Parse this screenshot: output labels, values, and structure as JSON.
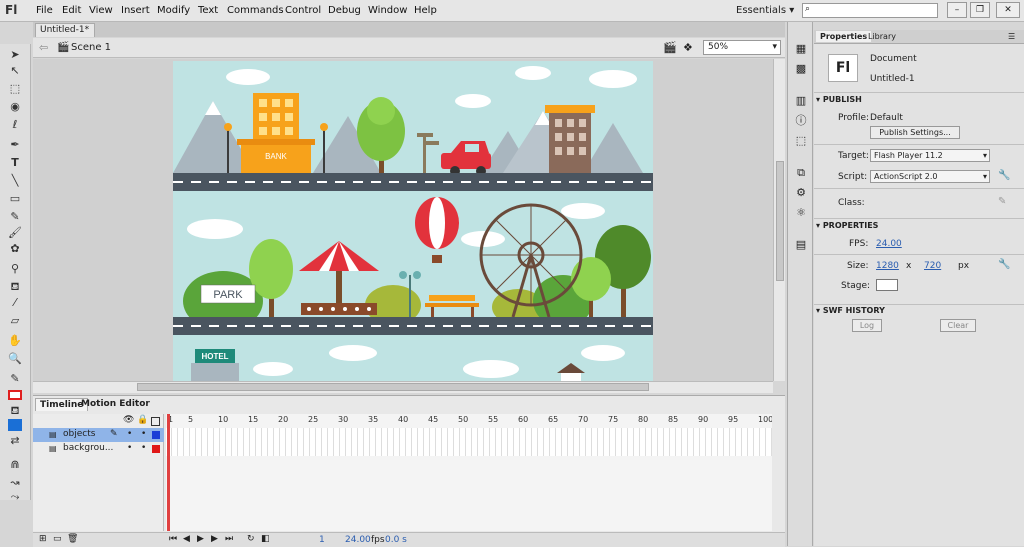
{
  "app": {
    "logo": "Fl"
  },
  "menu": [
    "File",
    "Edit",
    "View",
    "Insert",
    "Modify",
    "Text",
    "Commands",
    "Control",
    "Debug",
    "Window",
    "Help"
  ],
  "workspace": {
    "label": "Essentials"
  },
  "window_controls": {
    "minimize": "–",
    "restore": "❐",
    "close": "✕"
  },
  "document": {
    "tab": "Untitled-1*",
    "scene": "Scene 1",
    "zoom": "50%"
  },
  "stage": {
    "bank_label": "BANK",
    "park_label": "PARK",
    "hotel_label": "HOTEL"
  },
  "timeline": {
    "tabs": [
      "Timeline",
      "Motion Editor"
    ],
    "layers": [
      {
        "name": "objects",
        "color": "#1a3fd6"
      },
      {
        "name": "backgrou...",
        "color": "#e01818"
      }
    ],
    "frame_numbers": [
      "1",
      "5",
      "10",
      "15",
      "20",
      "25",
      "30",
      "35",
      "40",
      "45",
      "50",
      "55",
      "60",
      "65",
      "70",
      "75",
      "80",
      "85",
      "90",
      "95",
      "100"
    ],
    "status": {
      "frame": "1",
      "fps": "24.00",
      "fps_unit": "fps",
      "time": "0.0 s"
    }
  },
  "properties": {
    "tabs": [
      "Properties",
      "Library"
    ],
    "doc_icon": "Fl",
    "doc_type": "Document",
    "doc_name": "Untitled-1",
    "publish": {
      "header": "PUBLISH",
      "profile_label": "Profile:",
      "profile_value": "Default",
      "settings_button": "Publish Settings...",
      "target_label": "Target:",
      "target_value": "Flash Player 11.2",
      "script_label": "Script:",
      "script_value": "ActionScript 2.0",
      "class_label": "Class:"
    },
    "props": {
      "header": "PROPERTIES",
      "fps_label": "FPS:",
      "fps_value": "24.00",
      "size_label": "Size:",
      "width": "1280",
      "x": "x",
      "height": "720",
      "unit": "px",
      "stage_label": "Stage:",
      "stage_color": "#ffffff"
    },
    "swf": {
      "header": "SWF HISTORY",
      "log_button": "Log",
      "clear_button": "Clear"
    }
  },
  "colors": {
    "stroke": "#e02020",
    "fill": "#1a6fd6",
    "sky": "#bfe3e3",
    "road": "#4a5560"
  }
}
